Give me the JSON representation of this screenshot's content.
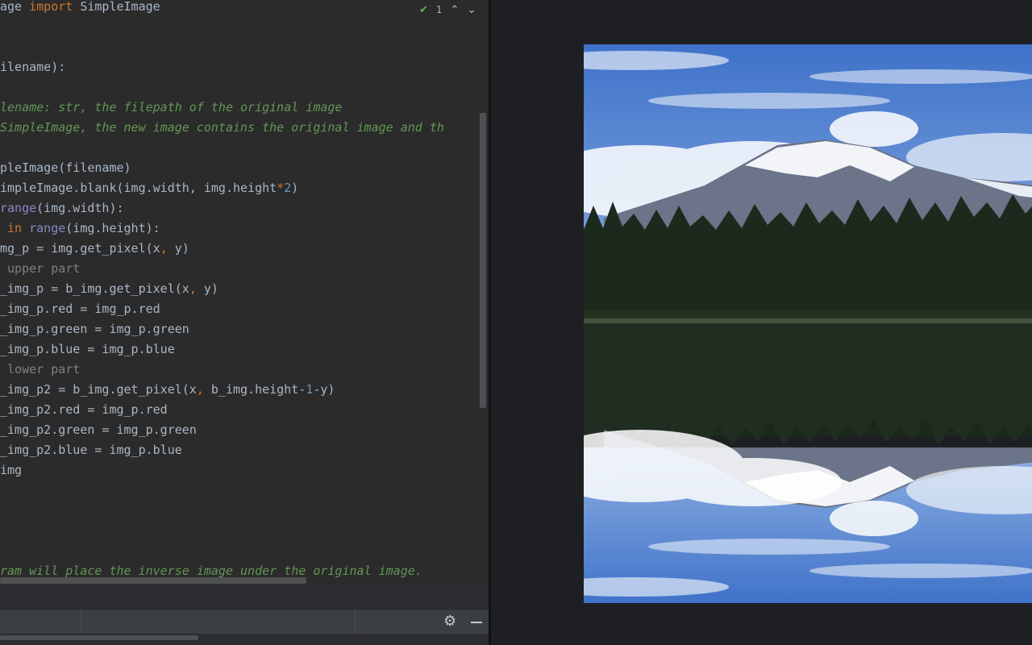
{
  "editor": {
    "inspection_count": "1",
    "lines": [
      [
        [
          "kw-",
          "age "
        ],
        [
          "kw",
          "import"
        ],
        [
          "",
          " SimpleImage"
        ]
      ],
      [],
      [],
      [
        [
          "",
          "ilename):"
        ]
      ],
      [],
      [
        [
          "doc",
          "lename: str, the filepath of the original image"
        ]
      ],
      [
        [
          "doc",
          "SimpleImage, the new image contains the original image and th"
        ]
      ],
      [],
      [
        [
          "",
          "pleImage(filename)"
        ]
      ],
      [
        [
          "",
          "impleImage.blank(img.width, img.height"
        ],
        [
          "kw",
          "*"
        ],
        [
          "num",
          "2"
        ],
        [
          "",
          ")"
        ]
      ],
      [
        [
          "bi",
          "range"
        ],
        [
          "",
          "(img.width):"
        ]
      ],
      [
        [
          "",
          " "
        ],
        [
          "kw",
          "in"
        ],
        [
          "",
          " "
        ],
        [
          "bi",
          "range"
        ],
        [
          "",
          "(img.height):"
        ]
      ],
      [
        [
          "",
          "mg_p = img.get_pixel(x"
        ],
        [
          "kw",
          ","
        ],
        [
          "",
          " y)"
        ]
      ],
      [
        [
          "cmt",
          " upper part"
        ]
      ],
      [
        [
          "",
          "_img_p = b_img.get_pixel(x"
        ],
        [
          "kw",
          ","
        ],
        [
          "",
          " y)"
        ]
      ],
      [
        [
          "",
          "_img_p.red = img_p.red"
        ]
      ],
      [
        [
          "",
          "_img_p.green = img_p.green"
        ]
      ],
      [
        [
          "",
          "_img_p.blue = img_p.blue"
        ]
      ],
      [
        [
          "cmt",
          " lower part"
        ]
      ],
      [
        [
          "",
          "_img_p2 = b_img.get_pixel(x"
        ],
        [
          "kw",
          ","
        ],
        [
          "",
          " b_img.height-"
        ],
        [
          "num",
          "1"
        ],
        [
          "",
          "-y)"
        ]
      ],
      [
        [
          "",
          "_img_p2.red = img_p.red"
        ]
      ],
      [
        [
          "",
          "_img_p2.green = img_p.green"
        ]
      ],
      [
        [
          "",
          "_img_p2.blue = img_p.blue"
        ]
      ],
      [
        [
          "",
          "img"
        ]
      ],
      [],
      [],
      [],
      [],
      [
        [
          "doc",
          "ram will place the inverse image under the original image."
        ]
      ]
    ]
  },
  "colors": {
    "editor_bg": "#2b2b2b",
    "keyword": "#cc7832",
    "builtin": "#8888c6",
    "number": "#6897bb",
    "docstring": "#629755",
    "comment": "#808080",
    "text": "#a9b7c6"
  },
  "icons": {
    "inspection": "check-icon",
    "prev": "chevron-up-icon",
    "next": "chevron-down-icon",
    "settings": "gear-icon",
    "hide": "minimize-icon"
  },
  "viewer": {
    "image": "mountain-lake-reflection"
  }
}
